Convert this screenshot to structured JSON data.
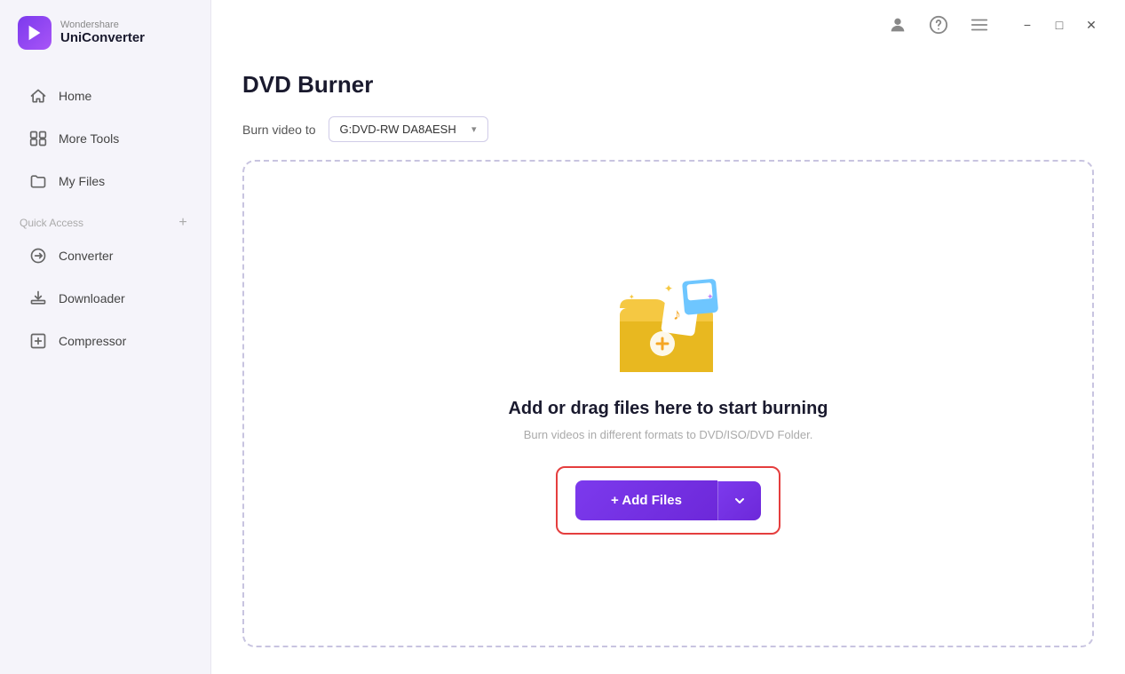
{
  "app": {
    "brand": "Wondershare",
    "product": "UniConverter"
  },
  "sidebar": {
    "nav_items": [
      {
        "id": "home",
        "label": "Home",
        "icon": "home-icon"
      },
      {
        "id": "more-tools",
        "label": "More Tools",
        "icon": "more-tools-icon"
      },
      {
        "id": "my-files",
        "label": "My Files",
        "icon": "my-files-icon"
      }
    ],
    "quick_access_label": "Quick Access",
    "quick_access_items": [
      {
        "id": "converter",
        "label": "Converter",
        "icon": "converter-icon"
      },
      {
        "id": "downloader",
        "label": "Downloader",
        "icon": "downloader-icon"
      },
      {
        "id": "compressor",
        "label": "Compressor",
        "icon": "compressor-icon"
      }
    ]
  },
  "topbar": {
    "user_icon": "user-icon",
    "help_icon": "help-icon",
    "menu_icon": "menu-icon"
  },
  "window_controls": {
    "minimize_label": "−",
    "maximize_label": "□",
    "close_label": "✕"
  },
  "page": {
    "title": "DVD Burner",
    "burn_to_label": "Burn video to",
    "drive_value": "G:DVD-RW DA8AESH",
    "drop_title": "Add or drag files here to start burning",
    "drop_subtitle": "Burn videos in different formats to DVD/ISO/DVD Folder.",
    "add_files_label": "+ Add Files",
    "add_files_dropdown_label": "▾"
  }
}
